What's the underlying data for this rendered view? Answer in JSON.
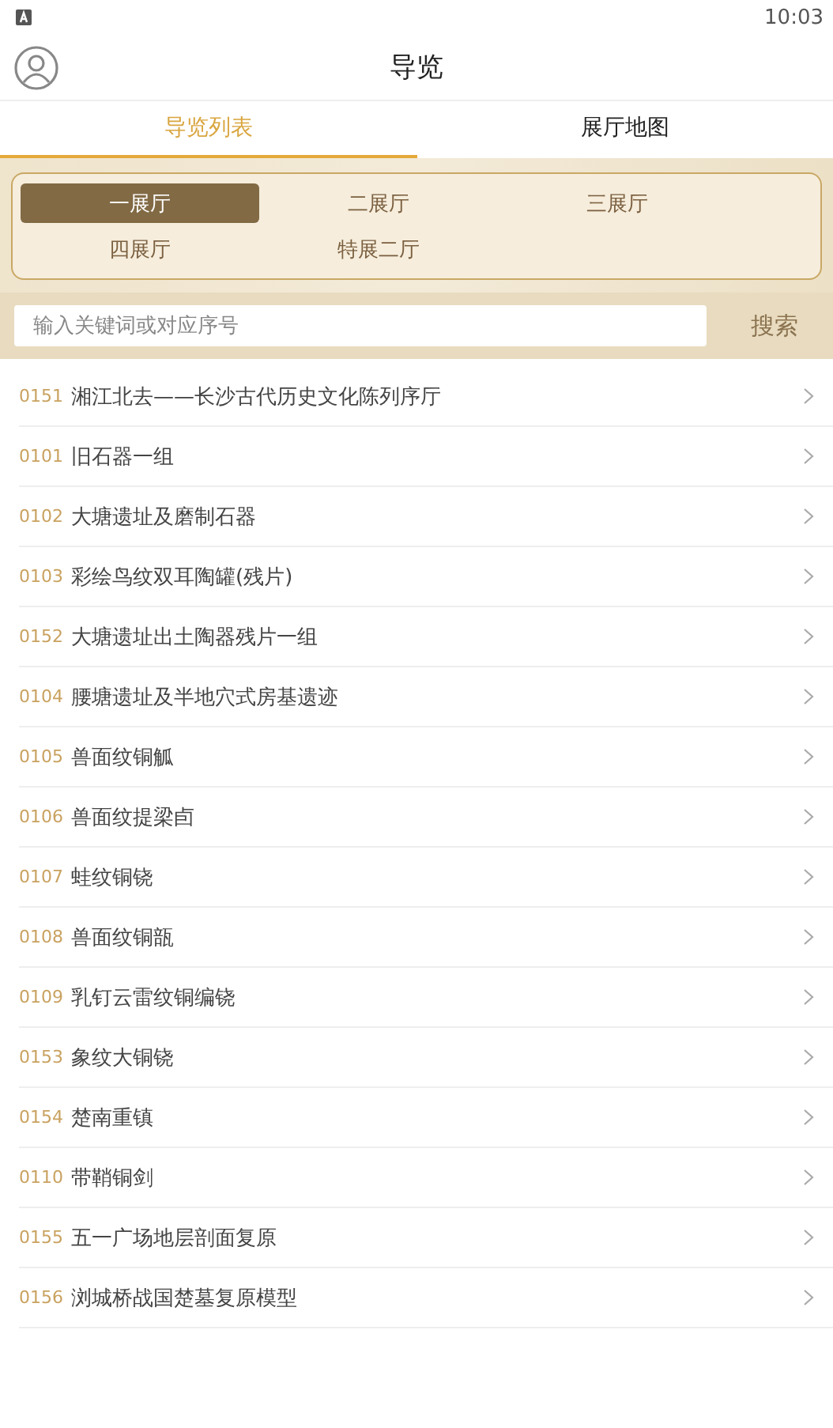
{
  "status_bar": {
    "time": "10:03"
  },
  "header": {
    "title": "导览"
  },
  "tabs": [
    {
      "label": "导览列表",
      "selected": true
    },
    {
      "label": "展厅地图",
      "selected": false
    }
  ],
  "halls": [
    {
      "label": "一展厅",
      "selected": true
    },
    {
      "label": "二展厅",
      "selected": false
    },
    {
      "label": "三展厅",
      "selected": false
    },
    {
      "label": "四展厅",
      "selected": false
    },
    {
      "label": "特展二厅",
      "selected": false
    }
  ],
  "search": {
    "placeholder": "输入关键词或对应序号",
    "button": "搜索"
  },
  "items": [
    {
      "number": "0151",
      "title": "湘江北去——长沙古代历史文化陈列序厅"
    },
    {
      "number": "0101",
      "title": "旧石器一组"
    },
    {
      "number": "0102",
      "title": "大塘遗址及磨制石器"
    },
    {
      "number": "0103",
      "title": "彩绘鸟纹双耳陶罐(残片)"
    },
    {
      "number": "0152",
      "title": "大塘遗址出土陶器残片一组"
    },
    {
      "number": "0104",
      "title": "腰塘遗址及半地穴式房基遗迹"
    },
    {
      "number": "0105",
      "title": "兽面纹铜觚"
    },
    {
      "number": "0106",
      "title": "兽面纹提梁卣"
    },
    {
      "number": "0107",
      "title": "蛙纹铜铙"
    },
    {
      "number": "0108",
      "title": "兽面纹铜瓿"
    },
    {
      "number": "0109",
      "title": "乳钉云雷纹铜编铙"
    },
    {
      "number": "0153",
      "title": "象纹大铜铙"
    },
    {
      "number": "0154",
      "title": "楚南重镇"
    },
    {
      "number": "0110",
      "title": "带鞘铜剑"
    },
    {
      "number": "0155",
      "title": "五一广场地层剖面复原"
    },
    {
      "number": "0156",
      "title": "浏城桥战国楚墓复原模型"
    }
  ]
}
